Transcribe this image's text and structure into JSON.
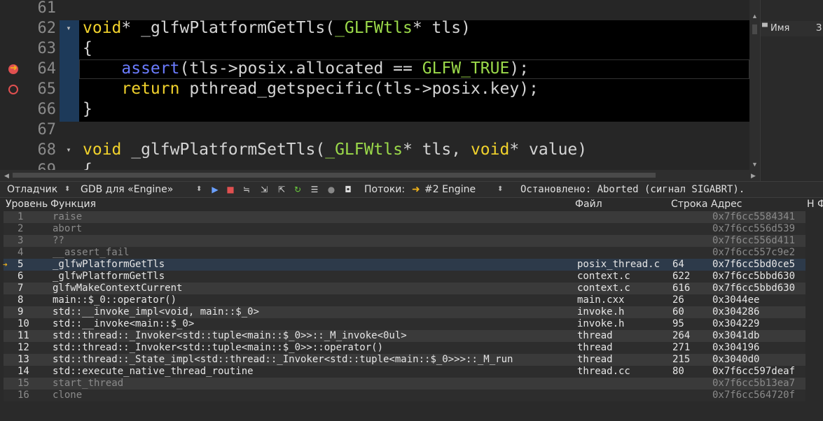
{
  "editor": {
    "lines": [
      {
        "num": "61",
        "fold": "",
        "text": ""
      },
      {
        "num": "62",
        "fold": "▾",
        "text": "void* _glfwPlatformGetTls(_GLFWtls* tls)"
      },
      {
        "num": "63",
        "fold": "",
        "text": "{"
      },
      {
        "num": "64",
        "fold": "",
        "text": "    assert(tls->posix.allocated == GLFW_TRUE);"
      },
      {
        "num": "65",
        "fold": "",
        "text": "    return pthread_getspecific(tls->posix.key);"
      },
      {
        "num": "66",
        "fold": "",
        "text": "}"
      },
      {
        "num": "67",
        "fold": "",
        "text": ""
      },
      {
        "num": "68",
        "fold": "▾",
        "text": "void _glfwPlatformSetTls(_GLFWtls* tls, void* value)"
      },
      {
        "num": "69",
        "fold": "",
        "text": "{"
      }
    ],
    "breakpoint_line": "64",
    "current_line": "64",
    "disabled_breakpoint_line": "65"
  },
  "right_panel": {
    "col_name": "Имя",
    "col_extra": "З"
  },
  "toolbar": {
    "debugger_label": "Отладчик",
    "gdb_label": "GDB для «Engine»",
    "threads_label": "Потоки:",
    "thread_value": "#2 Engine",
    "status": "Остановлено: Aborted (сигнал SIGABRT)."
  },
  "stack": {
    "headers": {
      "level": "Уровень",
      "function": "Функция",
      "file": "Файл",
      "line": "Строка",
      "address": "Адрес",
      "extra": "Н Ф"
    },
    "current_level": "5",
    "rows": [
      {
        "level": "1",
        "function": "raise",
        "file": "",
        "line": "",
        "address": "0x7f6cc5584341",
        "dim": true
      },
      {
        "level": "2",
        "function": "abort",
        "file": "",
        "line": "",
        "address": "0x7f6cc556d539",
        "dim": true
      },
      {
        "level": "3",
        "function": "??",
        "file": "",
        "line": "",
        "address": "0x7f6cc556d411",
        "dim": true
      },
      {
        "level": "4",
        "function": "__assert_fail",
        "file": "",
        "line": "",
        "address": "0x7f6cc557c9e2",
        "dim": true
      },
      {
        "level": "5",
        "function": "_glfwPlatformGetTls",
        "file": "posix_thread.c",
        "line": "64",
        "address": "0x7f6cc5bd0ce5",
        "dim": false
      },
      {
        "level": "6",
        "function": "_glfwPlatformGetTls",
        "file": "context.c",
        "line": "622",
        "address": "0x7f6cc5bbd630",
        "dim": false
      },
      {
        "level": "7",
        "function": "glfwMakeContextCurrent",
        "file": "context.c",
        "line": "616",
        "address": "0x7f6cc5bbd630",
        "dim": false
      },
      {
        "level": "8",
        "function": "main::$_0::operator()",
        "file": "main.cxx",
        "line": "26",
        "address": "0x3044ee",
        "dim": false
      },
      {
        "level": "9",
        "function": "std::__invoke_impl<void, main::$_0>",
        "file": "invoke.h",
        "line": "60",
        "address": "0x304286",
        "dim": false
      },
      {
        "level": "10",
        "function": "std::__invoke<main::$_0>",
        "file": "invoke.h",
        "line": "95",
        "address": "0x304229",
        "dim": false
      },
      {
        "level": "11",
        "function": "std::thread::_Invoker<std::tuple<main::$_0>>::_M_invoke<0ul>",
        "file": "thread",
        "line": "264",
        "address": "0x3041db",
        "dim": false
      },
      {
        "level": "12",
        "function": "std::thread::_Invoker<std::tuple<main::$_0>>::operator()",
        "file": "thread",
        "line": "271",
        "address": "0x304196",
        "dim": false
      },
      {
        "level": "13",
        "function": "std::thread::_State_impl<std::thread::_Invoker<std::tuple<main::$_0>>>::_M_run",
        "file": "thread",
        "line": "215",
        "address": "0x3040d0",
        "dim": false
      },
      {
        "level": "14",
        "function": "std::execute_native_thread_routine",
        "file": "thread.cc",
        "line": "80",
        "address": "0x7f6cc597deaf",
        "dim": false
      },
      {
        "level": "15",
        "function": "start_thread",
        "file": "",
        "line": "",
        "address": "0x7f6cc5b13ea7",
        "dim": true
      },
      {
        "level": "16",
        "function": "clone",
        "file": "",
        "line": "",
        "address": "0x7f6cc564720f",
        "dim": true
      }
    ]
  },
  "colors": {
    "keyword": "#f1d22c",
    "type": "#9bd94a",
    "function_call": "#6b7cff",
    "breakpoint": "#e05050",
    "current_arrow": "#f0b21a"
  }
}
